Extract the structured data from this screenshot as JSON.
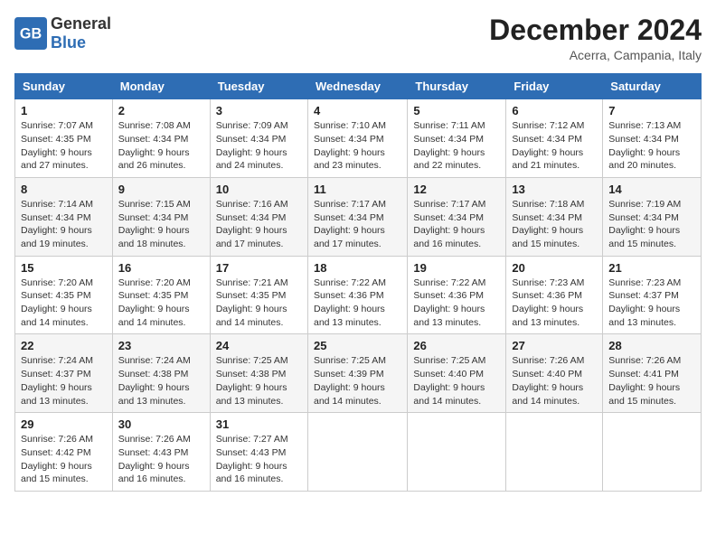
{
  "header": {
    "logo_general": "General",
    "logo_blue": "Blue",
    "month_title": "December 2024",
    "location": "Acerra, Campania, Italy"
  },
  "days_of_week": [
    "Sunday",
    "Monday",
    "Tuesday",
    "Wednesday",
    "Thursday",
    "Friday",
    "Saturday"
  ],
  "weeks": [
    [
      {
        "day": "1",
        "sunrise": "7:07 AM",
        "sunset": "4:35 PM",
        "daylight": "9 hours and 27 minutes."
      },
      {
        "day": "2",
        "sunrise": "7:08 AM",
        "sunset": "4:34 PM",
        "daylight": "9 hours and 26 minutes."
      },
      {
        "day": "3",
        "sunrise": "7:09 AM",
        "sunset": "4:34 PM",
        "daylight": "9 hours and 24 minutes."
      },
      {
        "day": "4",
        "sunrise": "7:10 AM",
        "sunset": "4:34 PM",
        "daylight": "9 hours and 23 minutes."
      },
      {
        "day": "5",
        "sunrise": "7:11 AM",
        "sunset": "4:34 PM",
        "daylight": "9 hours and 22 minutes."
      },
      {
        "day": "6",
        "sunrise": "7:12 AM",
        "sunset": "4:34 PM",
        "daylight": "9 hours and 21 minutes."
      },
      {
        "day": "7",
        "sunrise": "7:13 AM",
        "sunset": "4:34 PM",
        "daylight": "9 hours and 20 minutes."
      }
    ],
    [
      {
        "day": "8",
        "sunrise": "7:14 AM",
        "sunset": "4:34 PM",
        "daylight": "9 hours and 19 minutes."
      },
      {
        "day": "9",
        "sunrise": "7:15 AM",
        "sunset": "4:34 PM",
        "daylight": "9 hours and 18 minutes."
      },
      {
        "day": "10",
        "sunrise": "7:16 AM",
        "sunset": "4:34 PM",
        "daylight": "9 hours and 17 minutes."
      },
      {
        "day": "11",
        "sunrise": "7:17 AM",
        "sunset": "4:34 PM",
        "daylight": "9 hours and 17 minutes."
      },
      {
        "day": "12",
        "sunrise": "7:17 AM",
        "sunset": "4:34 PM",
        "daylight": "9 hours and 16 minutes."
      },
      {
        "day": "13",
        "sunrise": "7:18 AM",
        "sunset": "4:34 PM",
        "daylight": "9 hours and 15 minutes."
      },
      {
        "day": "14",
        "sunrise": "7:19 AM",
        "sunset": "4:34 PM",
        "daylight": "9 hours and 15 minutes."
      }
    ],
    [
      {
        "day": "15",
        "sunrise": "7:20 AM",
        "sunset": "4:35 PM",
        "daylight": "9 hours and 14 minutes."
      },
      {
        "day": "16",
        "sunrise": "7:20 AM",
        "sunset": "4:35 PM",
        "daylight": "9 hours and 14 minutes."
      },
      {
        "day": "17",
        "sunrise": "7:21 AM",
        "sunset": "4:35 PM",
        "daylight": "9 hours and 14 minutes."
      },
      {
        "day": "18",
        "sunrise": "7:22 AM",
        "sunset": "4:36 PM",
        "daylight": "9 hours and 13 minutes."
      },
      {
        "day": "19",
        "sunrise": "7:22 AM",
        "sunset": "4:36 PM",
        "daylight": "9 hours and 13 minutes."
      },
      {
        "day": "20",
        "sunrise": "7:23 AM",
        "sunset": "4:36 PM",
        "daylight": "9 hours and 13 minutes."
      },
      {
        "day": "21",
        "sunrise": "7:23 AM",
        "sunset": "4:37 PM",
        "daylight": "9 hours and 13 minutes."
      }
    ],
    [
      {
        "day": "22",
        "sunrise": "7:24 AM",
        "sunset": "4:37 PM",
        "daylight": "9 hours and 13 minutes."
      },
      {
        "day": "23",
        "sunrise": "7:24 AM",
        "sunset": "4:38 PM",
        "daylight": "9 hours and 13 minutes."
      },
      {
        "day": "24",
        "sunrise": "7:25 AM",
        "sunset": "4:38 PM",
        "daylight": "9 hours and 13 minutes."
      },
      {
        "day": "25",
        "sunrise": "7:25 AM",
        "sunset": "4:39 PM",
        "daylight": "9 hours and 14 minutes."
      },
      {
        "day": "26",
        "sunrise": "7:25 AM",
        "sunset": "4:40 PM",
        "daylight": "9 hours and 14 minutes."
      },
      {
        "day": "27",
        "sunrise": "7:26 AM",
        "sunset": "4:40 PM",
        "daylight": "9 hours and 14 minutes."
      },
      {
        "day": "28",
        "sunrise": "7:26 AM",
        "sunset": "4:41 PM",
        "daylight": "9 hours and 15 minutes."
      }
    ],
    [
      {
        "day": "29",
        "sunrise": "7:26 AM",
        "sunset": "4:42 PM",
        "daylight": "9 hours and 15 minutes."
      },
      {
        "day": "30",
        "sunrise": "7:26 AM",
        "sunset": "4:43 PM",
        "daylight": "9 hours and 16 minutes."
      },
      {
        "day": "31",
        "sunrise": "7:27 AM",
        "sunset": "4:43 PM",
        "daylight": "9 hours and 16 minutes."
      },
      null,
      null,
      null,
      null
    ]
  ],
  "labels": {
    "sunrise": "Sunrise:",
    "sunset": "Sunset:",
    "daylight": "Daylight:"
  }
}
